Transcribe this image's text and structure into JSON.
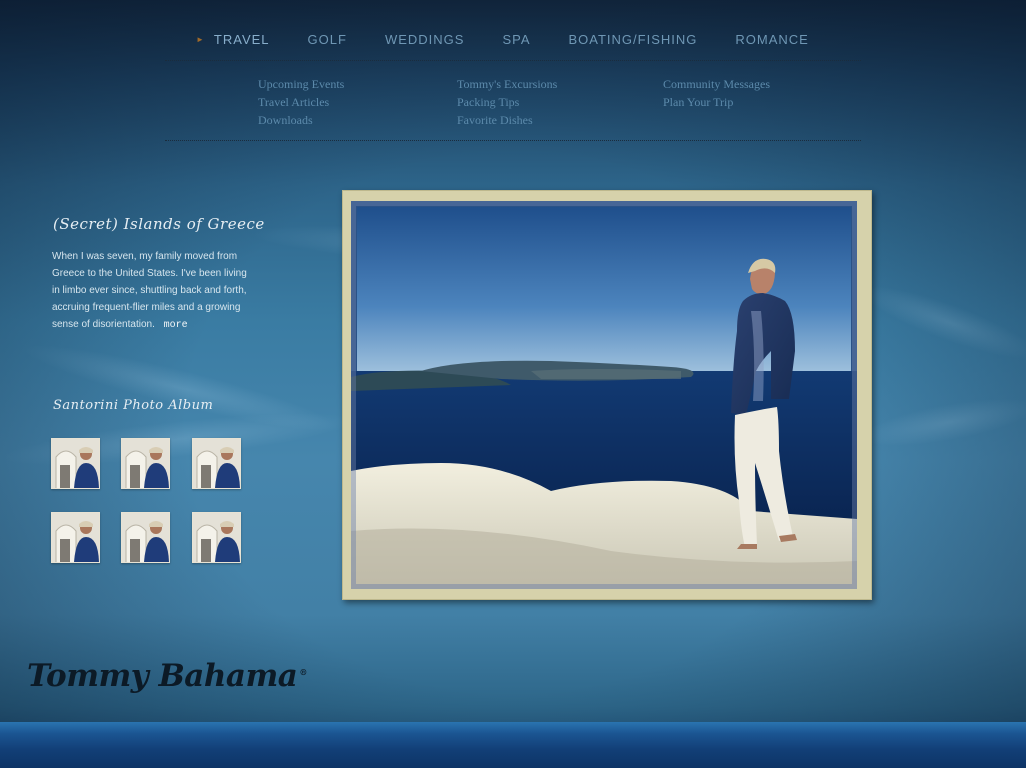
{
  "nav": {
    "active_arrow": "►",
    "items": [
      "TRAVEL",
      "GOLF",
      "WEDDINGS",
      "SPA",
      "BOATING/FISHING",
      "ROMANCE"
    ]
  },
  "subnav": {
    "columns": [
      [
        "Upcoming Events",
        "Travel Articles",
        "Downloads"
      ],
      [
        "Tommy's Excursions",
        "Packing Tips",
        "Favorite Dishes"
      ],
      [
        "Community Messages",
        "Plan Your Trip"
      ]
    ]
  },
  "article": {
    "title": "(Secret) Islands of Greece",
    "body": "When I was seven, my family moved from Greece to the United States. I've been living in limbo ever since, shuttling back and forth, accruing frequent-flier miles and a growing sense of disorientation.",
    "more": "more"
  },
  "album": {
    "title": "Santorini Photo Album",
    "thumbnails": 6
  },
  "logo": {
    "text": "Tommy Bahama",
    "registered": "®"
  },
  "colors": {
    "nav_text": "#6f97b4",
    "subnav_text": "#5c8aab",
    "frame": "#d6d2ab",
    "background": "#3a7ca3",
    "logo": "#0c1a26"
  }
}
